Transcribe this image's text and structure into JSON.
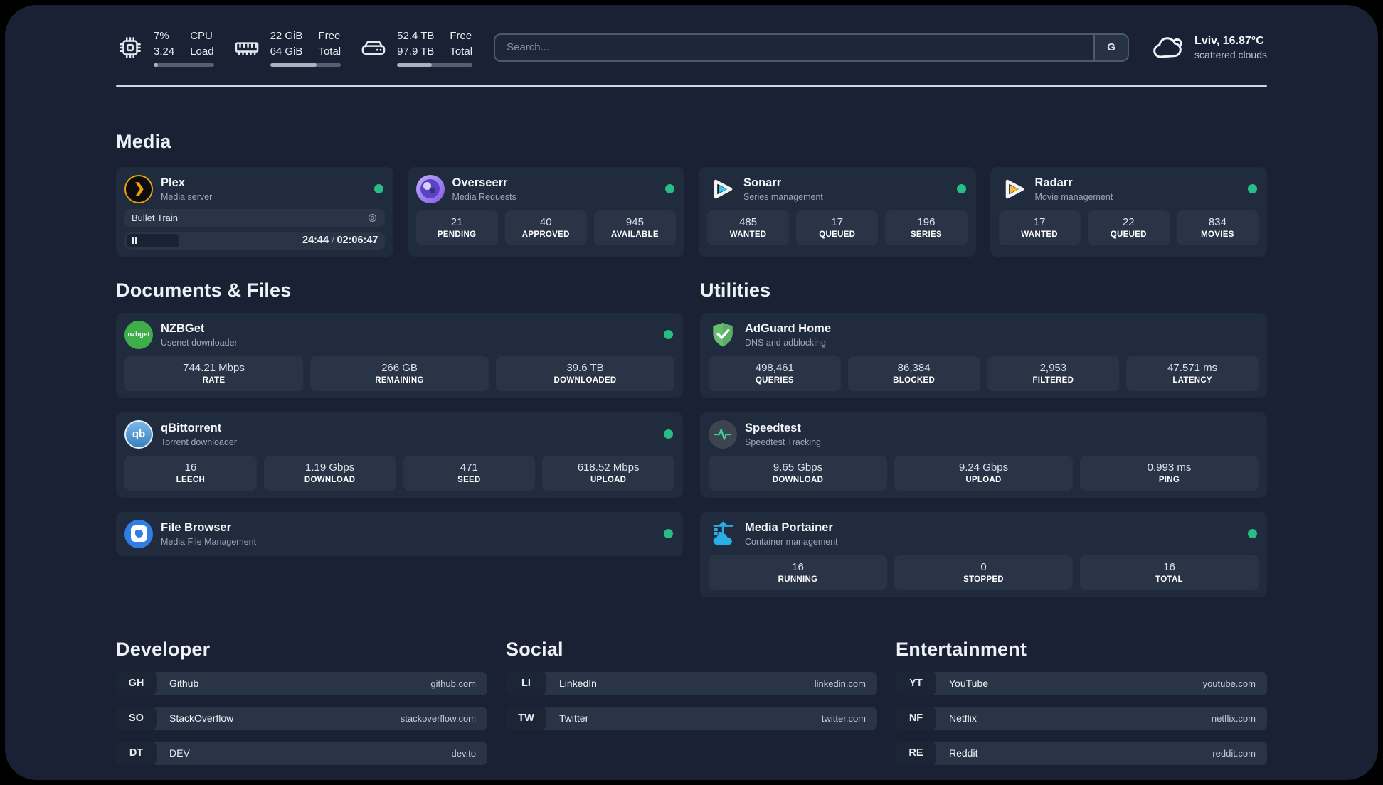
{
  "colors": {
    "background": "#1a2134",
    "card": "#212b3e",
    "tile": "#2a3447",
    "status_online_green": "#29bd86",
    "divider": "#cdd7e2",
    "plex_amber": "#e5a00d",
    "sonarr_cyan": "#35c5f4",
    "radarr_yellow": "#ffb53c",
    "nzbget_green": "#3fae4a",
    "qbittorrent_blue": "#3a7fc1",
    "adguard_green": "#68bd71",
    "speedtest_green": "#35d69e",
    "portainer_blue": "#28aee4",
    "filebrowser_blue": "#2e7ee5"
  },
  "header": {
    "system_stats": [
      {
        "icon": "cpu-icon",
        "value_1": "7%",
        "value_2": "3.24",
        "label_1": "CPU",
        "label_2": "Load",
        "progress_percent": 7
      },
      {
        "icon": "memory-icon",
        "value_1": "22 GiB",
        "value_2": "64 GiB",
        "label_1": "Free",
        "label_2": "Total",
        "progress_percent": 66
      },
      {
        "icon": "disk-icon",
        "value_1": "52.4 TB",
        "value_2": "97.9 TB",
        "label_1": "Free",
        "label_2": "Total",
        "progress_percent": 46
      }
    ],
    "search": {
      "placeholder": "Search...",
      "engine_button": "G"
    },
    "weather": {
      "icon": "cloud-icon",
      "location": "Lviv, 16.87°C",
      "condition": "scattered clouds"
    }
  },
  "sections": {
    "media": {
      "title": "Media",
      "cards": [
        {
          "icon": "plex-icon",
          "title": "Plex",
          "subtitle": "Media server",
          "online": true,
          "now_playing": {
            "title": "Bullet Train",
            "elapsed": "24:44",
            "time_separator": "/",
            "duration": "02:06:47",
            "progress_percent": 21
          }
        },
        {
          "icon": "overseerr-icon",
          "title": "Overseerr",
          "subtitle": "Media Requests",
          "online": true,
          "stats": [
            {
              "value": "21",
              "label": "PENDING"
            },
            {
              "value": "40",
              "label": "APPROVED"
            },
            {
              "value": "945",
              "label": "AVAILABLE"
            }
          ]
        },
        {
          "icon": "sonarr-icon",
          "title": "Sonarr",
          "subtitle": "Series management",
          "online": true,
          "stats": [
            {
              "value": "485",
              "label": "WANTED"
            },
            {
              "value": "17",
              "label": "QUEUED"
            },
            {
              "value": "196",
              "label": "SERIES"
            }
          ]
        },
        {
          "icon": "radarr-icon",
          "title": "Radarr",
          "subtitle": "Movie management",
          "online": true,
          "stats": [
            {
              "value": "17",
              "label": "WANTED"
            },
            {
              "value": "22",
              "label": "QUEUED"
            },
            {
              "value": "834",
              "label": "MOVIES"
            }
          ]
        }
      ]
    },
    "documents": {
      "title": "Documents & Files",
      "cards": [
        {
          "icon": "nzbget-icon",
          "title": "NZBGet",
          "subtitle": "Usenet downloader",
          "online": true,
          "stats": [
            {
              "value": "744.21 Mbps",
              "label": "RATE"
            },
            {
              "value": "266 GB",
              "label": "REMAINING"
            },
            {
              "value": "39.6 TB",
              "label": "DOWNLOADED"
            }
          ]
        },
        {
          "icon": "qbittorrent-icon",
          "title": "qBittorrent",
          "subtitle": "Torrent downloader",
          "online": true,
          "stats": [
            {
              "value": "16",
              "label": "LEECH"
            },
            {
              "value": "1.19 Gbps",
              "label": "DOWNLOAD"
            },
            {
              "value": "471",
              "label": "SEED"
            },
            {
              "value": "618.52 Mbps",
              "label": "UPLOAD"
            }
          ]
        },
        {
          "icon": "filebrowser-icon",
          "title": "File Browser",
          "subtitle": "Media File Management",
          "online": true,
          "stats": []
        }
      ]
    },
    "utilities": {
      "title": "Utilities",
      "cards": [
        {
          "icon": "adguard-icon",
          "title": "AdGuard Home",
          "subtitle": "DNS and adblocking",
          "online": false,
          "stats": [
            {
              "value": "498,461",
              "label": "QUERIES"
            },
            {
              "value": "86,384",
              "label": "BLOCKED"
            },
            {
              "value": "2,953",
              "label": "FILTERED"
            },
            {
              "value": "47.571 ms",
              "label": "LATENCY"
            }
          ]
        },
        {
          "icon": "speedtest-icon",
          "title": "Speedtest",
          "subtitle": "Speedtest Tracking",
          "online": false,
          "stats": [
            {
              "value": "9.65 Gbps",
              "label": "DOWNLOAD"
            },
            {
              "value": "9.24 Gbps",
              "label": "UPLOAD"
            },
            {
              "value": "0.993 ms",
              "label": "PING"
            }
          ]
        },
        {
          "icon": "portainer-icon",
          "title": "Media Portainer",
          "subtitle": "Container management",
          "online": true,
          "stats": [
            {
              "value": "16",
              "label": "RUNNING"
            },
            {
              "value": "0",
              "label": "STOPPED"
            },
            {
              "value": "16",
              "label": "TOTAL"
            }
          ]
        }
      ]
    },
    "bookmarks": [
      {
        "title": "Developer",
        "links": [
          {
            "abbr": "GH",
            "name": "Github",
            "url": "github.com"
          },
          {
            "abbr": "SO",
            "name": "StackOverflow",
            "url": "stackoverflow.com"
          },
          {
            "abbr": "DT",
            "name": "DEV",
            "url": "dev.to"
          }
        ]
      },
      {
        "title": "Social",
        "links": [
          {
            "abbr": "LI",
            "name": "LinkedIn",
            "url": "linkedin.com"
          },
          {
            "abbr": "TW",
            "name": "Twitter",
            "url": "twitter.com"
          }
        ]
      },
      {
        "title": "Entertainment",
        "links": [
          {
            "abbr": "YT",
            "name": "YouTube",
            "url": "youtube.com"
          },
          {
            "abbr": "NF",
            "name": "Netflix",
            "url": "netflix.com"
          },
          {
            "abbr": "RE",
            "name": "Reddit",
            "url": "reddit.com"
          }
        ]
      }
    ]
  }
}
